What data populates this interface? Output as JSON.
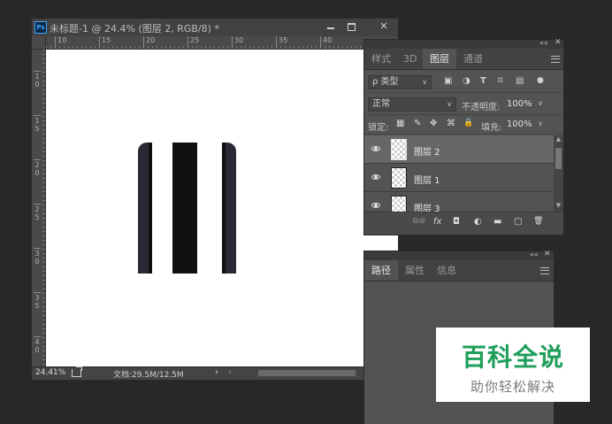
{
  "document": {
    "app_badge": "Ps",
    "title": "未标题-1 @ 24.4% (图层 2, RGB/8) *",
    "window_close": "✕",
    "ruler_h_ticks": [
      "10",
      "15",
      "20",
      "25",
      "30",
      "35",
      "40"
    ],
    "ruler_v_ticks": [
      "1\n0",
      "1\n5",
      "2\n0",
      "2\n5",
      "3\n0",
      "3\n5",
      "4\n0"
    ],
    "zoom": "24.41%",
    "doc_size": "文档:29.5M/12.5M",
    "nav_right": "›",
    "nav_left": "‹",
    "stripe_colors": [
      "#2a2a34",
      "#111111",
      "#ffffff",
      "#111111",
      "#ffffff",
      "#111111",
      "#2a2a34"
    ]
  },
  "layers_panel": {
    "collapse": "««",
    "close": "✕",
    "tabs": [
      "样式",
      "3D",
      "图层",
      "通道"
    ],
    "active_tab": "图层",
    "filter_label": "ρ 类型",
    "filter_tools": [
      "▣",
      "◑",
      "T",
      "⌑",
      "▤",
      "●"
    ],
    "blend_mode": "正常",
    "opacity_label": "不透明度:",
    "opacity_value": "100%",
    "lock_label": "锁定:",
    "lock_tools": [
      "▦",
      "✎",
      "✥",
      "⌘",
      "🔒"
    ],
    "fill_label": "填充:",
    "fill_value": "100%",
    "layers": [
      {
        "name": "图层 2",
        "selected": true
      },
      {
        "name": "图层 1",
        "selected": false
      },
      {
        "name": "图层 3",
        "selected": false
      }
    ],
    "footer_tools": [
      "⊖⊖",
      "fx",
      "◘",
      "◐",
      "▬",
      "▢",
      "🗑"
    ]
  },
  "paths_panel": {
    "collapse": "««",
    "close": "✕",
    "tabs": [
      "路径",
      "属性",
      "信息"
    ],
    "active_tab": "路径"
  },
  "watermark": {
    "title": "百科全说",
    "subtitle": "助你轻松解决"
  }
}
